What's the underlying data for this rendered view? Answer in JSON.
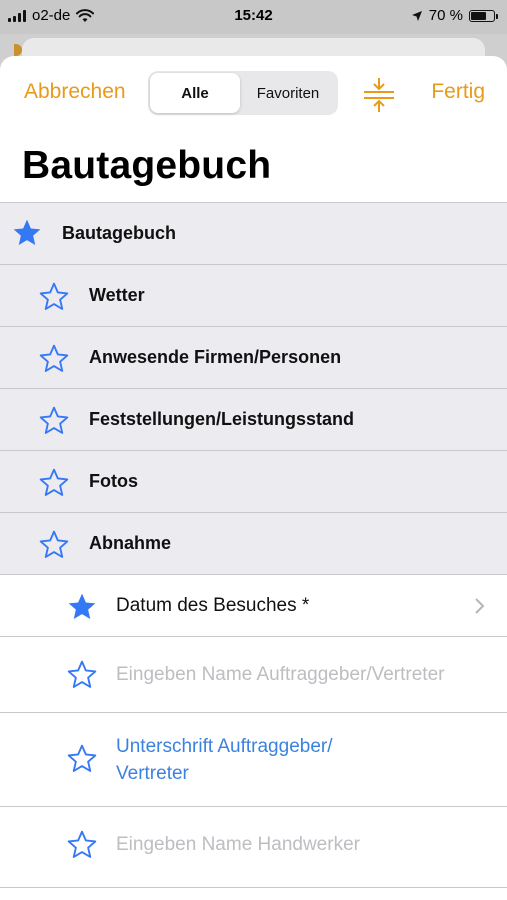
{
  "status_bar": {
    "carrier": "o2-de",
    "time": "15:42",
    "battery": "70 %",
    "battery_level": 0.7
  },
  "nav": {
    "cancel_label": "Abbrechen",
    "done_label": "Fertig",
    "segments": [
      "Alle",
      "Favoriten"
    ],
    "selected_segment": "Alle",
    "collapse_icon": "collapse-arrows-icon"
  },
  "page_title": "Bautagebuch",
  "colors": {
    "accent_orange": "#e89a1a",
    "star_blue": "#3478f6",
    "link_blue": "#3b82e0",
    "placeholder_grey": "#bdbdc2",
    "section_bg": "#ebebf0"
  },
  "items": [
    {
      "label": "Bautagebuch",
      "starred": true,
      "level": 0
    },
    {
      "label": "Wetter",
      "starred": false,
      "level": 1
    },
    {
      "label": "Anwesende Firmen/Personen",
      "starred": false,
      "level": 1
    },
    {
      "label": "Feststellungen/Leistungsstand",
      "starred": false,
      "level": 1
    },
    {
      "label": "Fotos",
      "starred": false,
      "level": 1
    },
    {
      "label": "Abnahme",
      "starred": false,
      "level": 1
    },
    {
      "label": "Datum des Besuches *",
      "starred": true,
      "level": 2,
      "has_chevron": true
    },
    {
      "label": "Eingeben Name Auftraggeber/Vertreter",
      "starred": false,
      "level": 2,
      "placeholder": true
    },
    {
      "label_line1": "Unterschrift Auftraggeber/",
      "label_line2": "Vertreter",
      "starred": false,
      "level": 2,
      "link": true
    },
    {
      "label": "Eingeben Name Handwerker",
      "starred": false,
      "level": 2,
      "placeholder": true
    }
  ]
}
